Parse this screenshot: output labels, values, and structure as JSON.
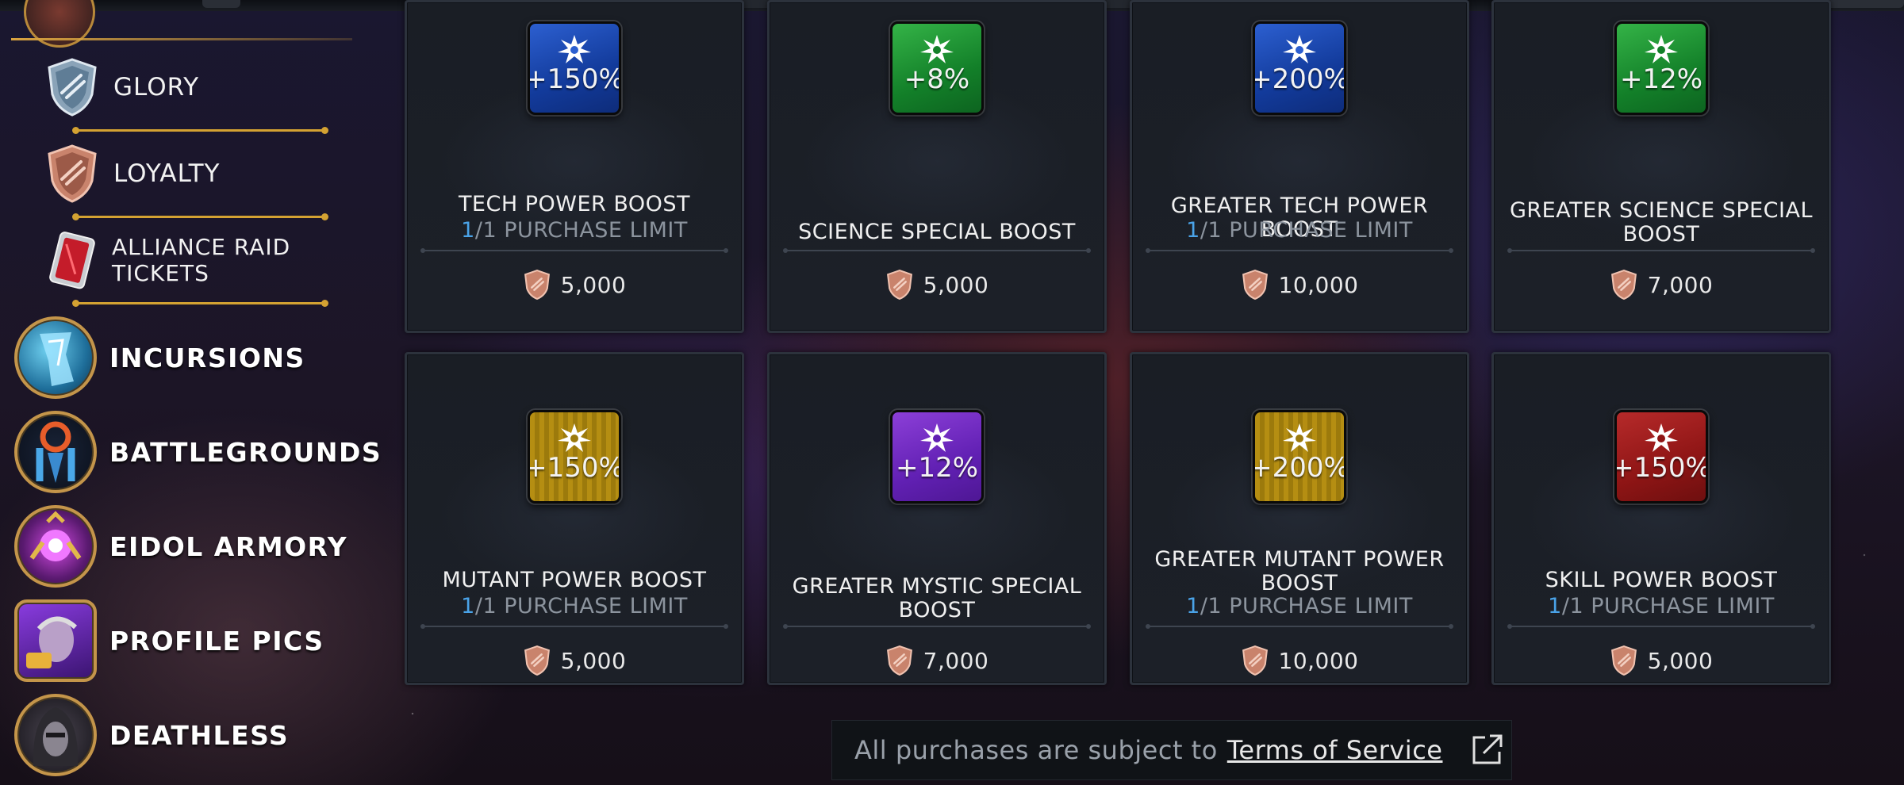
{
  "sidebar": {
    "sub_items": [
      {
        "label": "GLORY",
        "icon": "glory-shield-icon"
      },
      {
        "label": "LOYALTY",
        "icon": "loyalty-shield-icon"
      },
      {
        "label": "ALLIANCE RAID TICKETS",
        "icon": "raid-ticket-icon"
      }
    ],
    "main_items": [
      {
        "label": "INCURSIONS",
        "icon": "incursions-icon"
      },
      {
        "label": "BATTLEGROUNDS",
        "icon": "battlegrounds-icon"
      },
      {
        "label": "EIDOL ARMORY",
        "icon": "eidol-armory-icon"
      },
      {
        "label": "PROFILE PICS",
        "icon": "profile-pics-icon"
      },
      {
        "label": "DEATHLESS",
        "icon": "deathless-icon"
      }
    ]
  },
  "products": [
    {
      "tile_color": "blue",
      "tile_value": "+150%",
      "name": "TECH POWER BOOST",
      "limit_current": "1",
      "limit_rest": "/1 PURCHASE LIMIT",
      "price": "5,000",
      "currency_icon": "loyalty-shield-icon"
    },
    {
      "tile_color": "green",
      "tile_value": "+8%",
      "name": "SCIENCE SPECIAL BOOST",
      "limit_current": "",
      "limit_rest": "",
      "price": "5,000",
      "currency_icon": "loyalty-shield-icon"
    },
    {
      "tile_color": "blue",
      "tile_value": "+200%",
      "name": "GREATER TECH POWER BOOST",
      "limit_current": "1",
      "limit_rest": "/1 PURCHASE LIMIT",
      "price": "10,000",
      "currency_icon": "loyalty-shield-icon"
    },
    {
      "tile_color": "green",
      "tile_value": "+12%",
      "name": "GREATER SCIENCE SPECIAL BOOST",
      "limit_current": "",
      "limit_rest": "",
      "price": "7,000",
      "currency_icon": "loyalty-shield-icon"
    },
    {
      "tile_color": "gold",
      "tile_value": "+150%",
      "name": "MUTANT POWER BOOST",
      "limit_current": "1",
      "limit_rest": "/1 PURCHASE LIMIT",
      "price": "5,000",
      "currency_icon": "loyalty-shield-icon"
    },
    {
      "tile_color": "purple",
      "tile_value": "+12%",
      "name": "GREATER MYSTIC SPECIAL BOOST",
      "limit_current": "",
      "limit_rest": "",
      "price": "7,000",
      "currency_icon": "loyalty-shield-icon"
    },
    {
      "tile_color": "gold",
      "tile_value": "+200%",
      "name": "GREATER MUTANT POWER BOOST",
      "limit_current": "1",
      "limit_rest": "/1 PURCHASE LIMIT",
      "price": "10,000",
      "currency_icon": "loyalty-shield-icon"
    },
    {
      "tile_color": "red",
      "tile_value": "+150%",
      "name": "SKILL POWER BOOST",
      "limit_current": "1",
      "limit_rest": "/1 PURCHASE LIMIT",
      "price": "5,000",
      "currency_icon": "loyalty-shield-icon"
    }
  ],
  "footer": {
    "text": "All purchases are subject to",
    "link": "Terms of Service",
    "icon": "external-link-icon"
  }
}
